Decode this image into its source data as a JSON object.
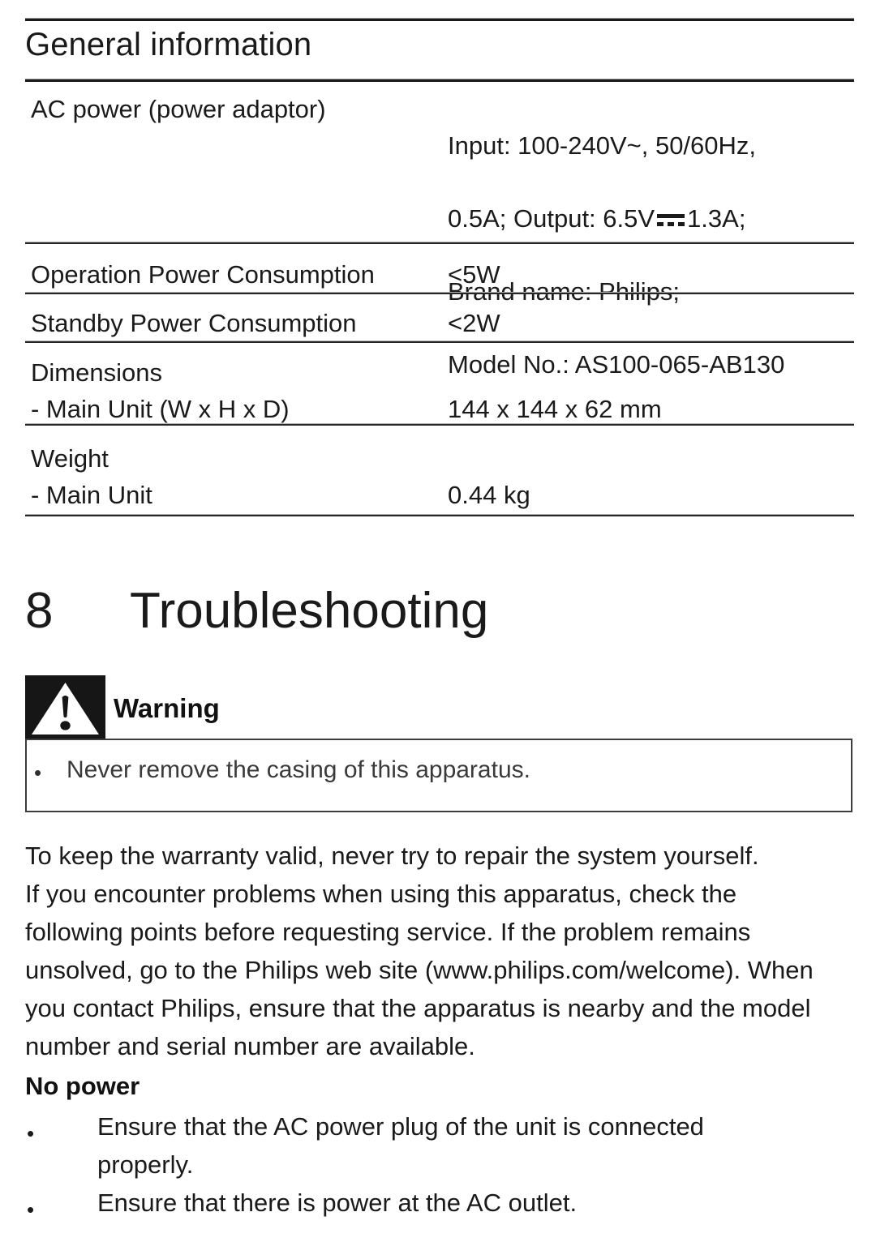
{
  "section": {
    "title": "General information"
  },
  "spec_table": {
    "rows": [
      {
        "label": "AC power (power adaptor)",
        "value_lines": [
          "Input: 100-240V~, 50/60Hz,",
          "0.5A; Output: 6.5V",
          "1.3A;",
          "Brand name: Philips;",
          "Model No.: AS100-065-AB130"
        ],
        "has_dc_symbol": true
      },
      {
        "label": "Operation Power Consumption",
        "value": "<5W"
      },
      {
        "label": "Standby Power Consumption",
        "value": "<2W"
      },
      {
        "label": "Dimensions\n- Main Unit (W x H x D)",
        "value": "144 x 144 x 62 mm"
      },
      {
        "label": "Weight\n- Main Unit",
        "value": "0.44 kg"
      }
    ]
  },
  "chapter": {
    "number": "8",
    "title": "Troubleshooting"
  },
  "warning": {
    "icon": "warning-triangle-icon",
    "label": "Warning",
    "bullet_glyph": "•",
    "items": [
      "Never remove the casing of this apparatus."
    ]
  },
  "body": {
    "lines": [
      "To keep the warranty valid, never try to repair the system yourself.",
      "If you encounter problems when using this apparatus, check the",
      "following points before requesting service. If the problem remains",
      "unsolved, go to the Philips web site (www.philips.com/welcome). When",
      "you contact Philips, ensure that the apparatus is nearby and the model",
      "number and serial number are available."
    ]
  },
  "no_power": {
    "heading": "No power",
    "bullet_glyph": "•",
    "items": [
      "Ensure that the AC power plug of the unit is connected\nproperly.",
      "Ensure that there is power at the AC outlet."
    ]
  },
  "colors": {
    "text": "#1a1a1a",
    "rule": "#1a1a1a",
    "warning_icon_bg": "#161616",
    "warning_box_border": "#3d3d3d"
  }
}
